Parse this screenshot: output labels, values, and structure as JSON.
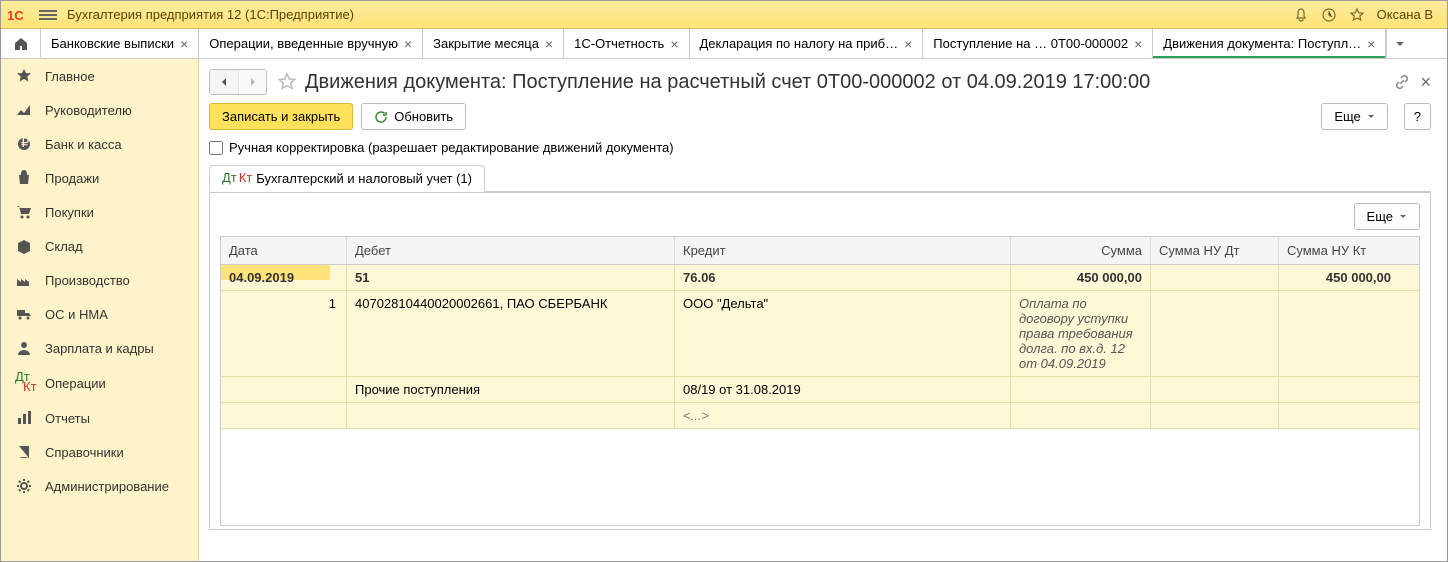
{
  "app": {
    "title": "Бухгалтерия предприятия 12  (1С:Предприятие)",
    "user": "Оксана В"
  },
  "tabs": [
    {
      "label": "Банковские выписки"
    },
    {
      "label": "Операции, введенные вручную"
    },
    {
      "label": "Закрытие месяца"
    },
    {
      "label": "1С-Отчетность"
    },
    {
      "label": "Декларация по налогу на приб…"
    },
    {
      "label": "Поступление на …   0Т00-000002"
    },
    {
      "label": "Движения документа: Поступл…",
      "active": true
    }
  ],
  "sidebar": [
    {
      "label": "Главное",
      "icon": "star"
    },
    {
      "label": "Руководителю",
      "icon": "chart"
    },
    {
      "label": "Банк и касса",
      "icon": "coin"
    },
    {
      "label": "Продажи",
      "icon": "bag"
    },
    {
      "label": "Покупки",
      "icon": "cart"
    },
    {
      "label": "Склад",
      "icon": "box"
    },
    {
      "label": "Производство",
      "icon": "factory"
    },
    {
      "label": "ОС и НМА",
      "icon": "truck"
    },
    {
      "label": "Зарплата и кадры",
      "icon": "person"
    },
    {
      "label": "Операции",
      "icon": "dtkt"
    },
    {
      "label": "Отчеты",
      "icon": "bars"
    },
    {
      "label": "Справочники",
      "icon": "book"
    },
    {
      "label": "Администрирование",
      "icon": "gear"
    }
  ],
  "page": {
    "title": "Движения документа: Поступление на расчетный счет 0Т00-000002 от 04.09.2019 17:00:00",
    "save_close": "Записать и закрыть",
    "refresh": "Обновить",
    "more": "Еще",
    "help": "?",
    "manual_edit": "Ручная корректировка (разрешает редактирование движений документа)",
    "data_tab": "Бухгалтерский и налоговый учет (1)"
  },
  "grid": {
    "headers": {
      "date": "Дата",
      "debit": "Дебет",
      "credit": "Кредит",
      "sum": "Сумма",
      "nudt": "Сумма НУ Дт",
      "nukt": "Сумма НУ Кт"
    },
    "more": "Еще",
    "row": {
      "date": "04.09.2019",
      "num": "1",
      "debit_acc": "51",
      "credit_acc": "76.06",
      "sum": "450 000,00",
      "nukt": "450 000,00",
      "debit_sub1": "40702810440020002661, ПАО СБЕРБАНК",
      "debit_sub2": "Прочие поступления",
      "credit_sub1": "ООО \"Дельта\"",
      "credit_sub2": "08/19 от 31.08.2019",
      "credit_sub3": "<...>",
      "desc": "Оплата по договору уступки права требования долга. по вх.д. 12 от 04.09.2019"
    }
  }
}
